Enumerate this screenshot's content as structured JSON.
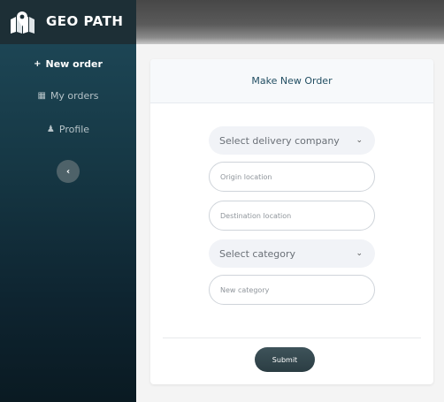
{
  "brand": {
    "title": "GEO PATH",
    "icon": "map-pin-icon"
  },
  "nav": {
    "items": [
      {
        "icon": "plus-icon",
        "glyph": "+",
        "label": "New order"
      },
      {
        "icon": "boxes-icon",
        "glyph": "▦",
        "label": "My orders"
      },
      {
        "icon": "user-icon",
        "glyph": "♟",
        "label": "Profile"
      }
    ],
    "collapse_glyph": "‹"
  },
  "form": {
    "title": "Make New Order",
    "delivery_company": {
      "value": "Select delivery company"
    },
    "origin": {
      "placeholder": "Origin location",
      "value": ""
    },
    "destination": {
      "placeholder": "Destination location",
      "value": ""
    },
    "category": {
      "value": "Select category"
    },
    "new_category": {
      "placeholder": "New category",
      "value": ""
    },
    "submit_label": "Submit",
    "chevron_glyph": "⌄"
  },
  "colors": {
    "sidebar_top": "#1f4a5a",
    "sidebar_bottom": "#0a1a22",
    "title_accent": "#234f63",
    "submit_bg": "#33474e"
  }
}
